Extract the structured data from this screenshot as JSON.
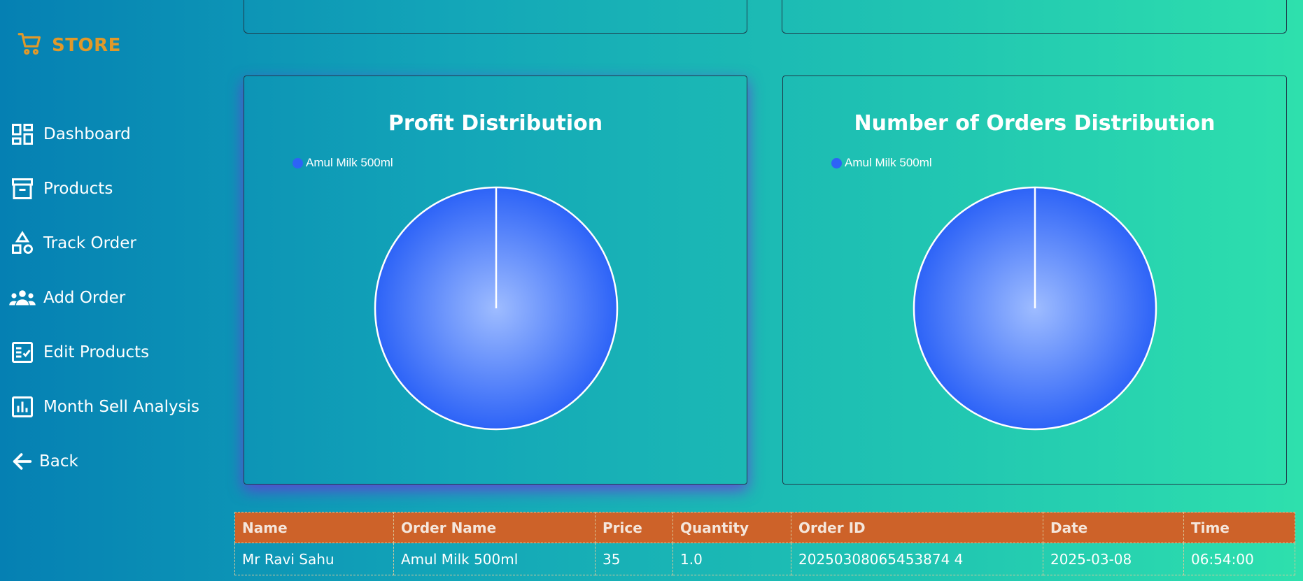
{
  "brand": {
    "label": "STORE",
    "icon": "cart-icon",
    "color": "#e0992a"
  },
  "sidebar": {
    "items": [
      {
        "label": "Dashboard",
        "icon": "dashboard-icon"
      },
      {
        "label": "Products",
        "icon": "archive-icon"
      },
      {
        "label": "Track Order",
        "icon": "shapes-icon"
      },
      {
        "label": "Add Order",
        "icon": "group-icon"
      },
      {
        "label": "Edit Products",
        "icon": "checklist-icon"
      },
      {
        "label": "Month Sell Analysis",
        "icon": "bar-chart-icon"
      },
      {
        "label": "Back",
        "icon": "arrow-left-icon"
      }
    ]
  },
  "charts": {
    "profit": {
      "title": "Profit Distribution"
    },
    "orders": {
      "title": "Number of Orders Distribution"
    }
  },
  "chart_data": [
    {
      "type": "pie",
      "title": "Profit Distribution",
      "legend": "top-left",
      "categories": [
        "Amul Milk 500ml"
      ],
      "values": [
        100
      ],
      "colors": [
        "#2d63f7"
      ]
    },
    {
      "type": "pie",
      "title": "Number of Orders Distribution",
      "legend": "top-left",
      "categories": [
        "Amul Milk 500ml"
      ],
      "values": [
        100
      ],
      "colors": [
        "#2d63f7"
      ]
    }
  ],
  "table": {
    "headers": [
      "Name",
      "Order Name",
      "Price",
      "Quantity",
      "Order ID",
      "Date",
      "Time"
    ],
    "rows": [
      [
        "Mr Ravi Sahu",
        "Amul Milk 500ml",
        "35",
        "1.0",
        "20250308065453874 4",
        "2025-03-08",
        "06:54:00"
      ]
    ]
  },
  "colors": {
    "header_bg": "#cd6229",
    "pie_fill": "#2d63f7",
    "accent_shadow": "#7a28dc"
  }
}
